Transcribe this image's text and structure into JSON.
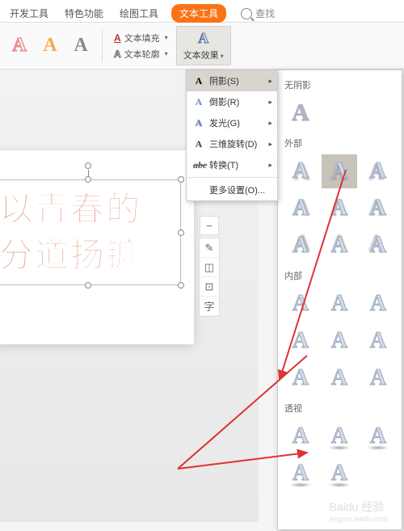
{
  "ribbon": {
    "tabs": [
      "开发工具",
      "特色功能",
      "绘图工具",
      "文本工具"
    ],
    "active_tab": "文本工具",
    "search_label": "查找"
  },
  "toolbar": {
    "style_glyph": "A",
    "text_fill_label": "文本填充",
    "text_outline_label": "文本轮廓",
    "text_effect_label": "文本效果"
  },
  "submenu": {
    "items": [
      {
        "label": "阴影(S)",
        "icon": "shadow"
      },
      {
        "label": "倒影(R)",
        "icon": "reflect"
      },
      {
        "label": "发光(G)",
        "icon": "glow"
      },
      {
        "label": "三维旋转(D)",
        "icon": "3d"
      },
      {
        "label": "转换(T)",
        "icon": "transform"
      }
    ],
    "more_settings": "更多设置(O)..."
  },
  "shadow_panel": {
    "sections": {
      "none": "无阴影",
      "outer": "外部",
      "inner": "内部",
      "perspective": "透视"
    },
    "glyph": "A"
  },
  "slide": {
    "line1": "以青春的",
    "line2": "分道扬镳"
  },
  "side_tools": {
    "items": [
      "−",
      "✎",
      "◫",
      "⊡",
      "字"
    ]
  },
  "watermark": {
    "main": "Baidu 经验",
    "sub": "jingyan.baidu.com"
  }
}
